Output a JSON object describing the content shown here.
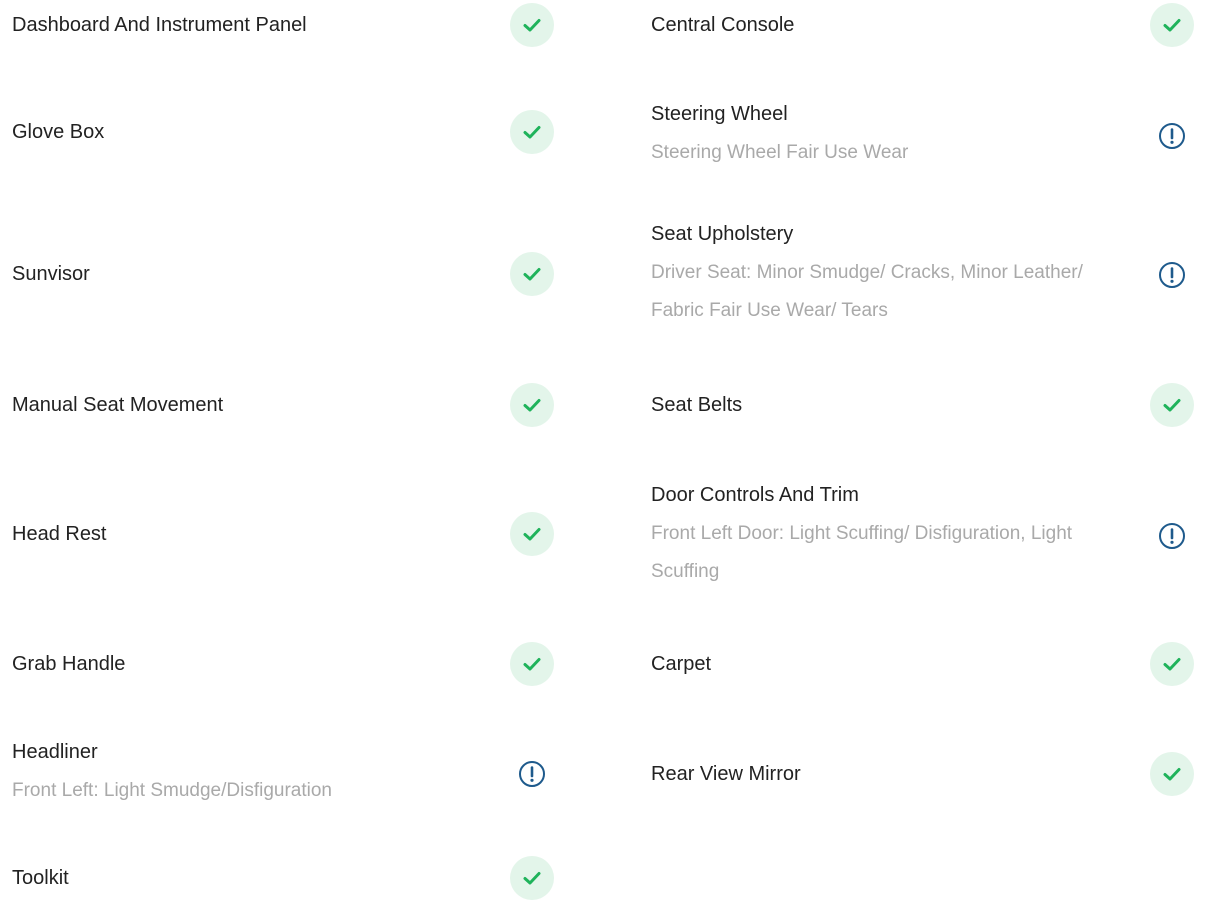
{
  "colors": {
    "ok_bg": "#e3f5ea",
    "ok_check": "#1fb35b",
    "warn_ring": "#1e5a8c",
    "label": "#222222",
    "note": "#a9a9a9"
  },
  "left_items": [
    {
      "label": "Dashboard And Instrument Panel",
      "status": "ok",
      "icon": "check-icon"
    },
    {
      "label": "Glove Box",
      "status": "ok",
      "icon": "check-icon"
    },
    {
      "label": "Sunvisor",
      "status": "ok",
      "icon": "check-icon"
    },
    {
      "label": "Manual Seat Movement",
      "status": "ok",
      "icon": "check-icon"
    },
    {
      "label": "Head Rest",
      "status": "ok",
      "icon": "check-icon"
    },
    {
      "label": "Grab Handle",
      "status": "ok",
      "icon": "check-icon"
    },
    {
      "label": "Headliner",
      "note": "Front Left: Light Smudge/Disfiguration",
      "status": "warning",
      "icon": "exclamation-circle-icon"
    },
    {
      "label": "Toolkit",
      "status": "ok",
      "icon": "check-icon"
    }
  ],
  "right_items": [
    {
      "label": "Central Console",
      "status": "ok",
      "icon": "check-icon"
    },
    {
      "label": "Steering Wheel",
      "note": "Steering Wheel Fair Use Wear",
      "status": "warning",
      "icon": "exclamation-circle-icon"
    },
    {
      "label": "Seat Upholstery",
      "note": "Driver Seat: Minor Smudge/ Cracks, Minor Leather/ Fabric Fair Use Wear/ Tears",
      "status": "warning",
      "icon": "exclamation-circle-icon"
    },
    {
      "label": "Seat Belts",
      "status": "ok",
      "icon": "check-icon"
    },
    {
      "label": "Door Controls And Trim",
      "note": "Front Left Door: Light Scuffing/ Disfiguration, Light Scuffing",
      "status": "warning",
      "icon": "exclamation-circle-icon"
    },
    {
      "label": "Carpet",
      "status": "ok",
      "icon": "check-icon"
    },
    {
      "label": "Rear View Mirror",
      "status": "ok",
      "icon": "check-icon"
    }
  ]
}
